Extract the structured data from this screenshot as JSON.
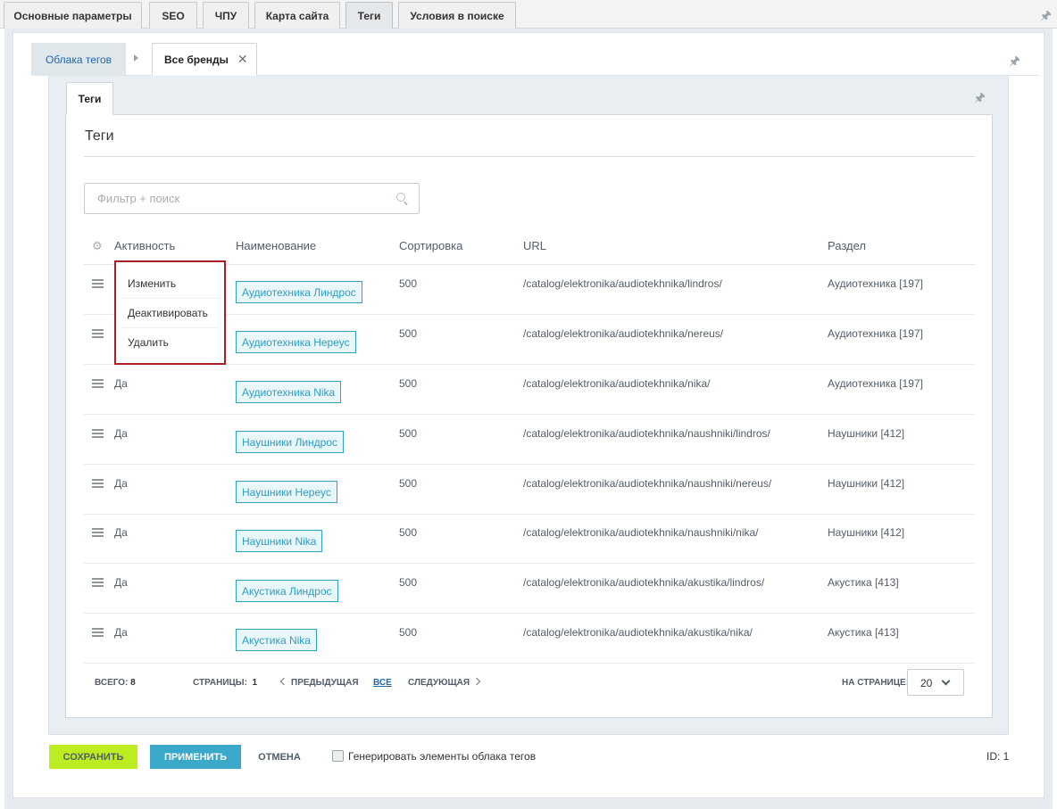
{
  "top_tabs": [
    {
      "label": "Основные параметры"
    },
    {
      "label": "SEO"
    },
    {
      "label": "ЧПУ"
    },
    {
      "label": "Карта сайта"
    },
    {
      "label": "Теги"
    },
    {
      "label": "Условия в поиске"
    }
  ],
  "sub_tabs": {
    "cloud": "Облака тегов",
    "brands": "Все бренды",
    "close": "✕"
  },
  "inner_tab": "Теги",
  "section_title": "Теги",
  "search": {
    "placeholder": "Фильтр + поиск",
    "value": ""
  },
  "table": {
    "headers": {
      "active": "Активность",
      "name": "Наименование",
      "sort": "Сортировка",
      "url": "URL",
      "section": "Раздел"
    },
    "rows": [
      {
        "active": "",
        "name": "Аудиотехника Линдрос",
        "sort": "500",
        "url": "/catalog/elektronika/audiotekhnika/lindros/",
        "section": "Аудиотехника [197]"
      },
      {
        "active": "",
        "name": "Аудиотехника Нереус",
        "sort": "500",
        "url": "/catalog/elektronika/audiotekhnika/nereus/",
        "section": "Аудиотехника [197]"
      },
      {
        "active": "Да",
        "name": "Аудиотехника Nika",
        "sort": "500",
        "url": "/catalog/elektronika/audiotekhnika/nika/",
        "section": "Аудиотехника [197]"
      },
      {
        "active": "Да",
        "name": "Наушники Линдрос",
        "sort": "500",
        "url": "/catalog/elektronika/audiotekhnika/naushniki/lindros/",
        "section": "Наушники [412]"
      },
      {
        "active": "Да",
        "name": "Наушники Нереус",
        "sort": "500",
        "url": "/catalog/elektronika/audiotekhnika/naushniki/nereus/",
        "section": "Наушники [412]"
      },
      {
        "active": "Да",
        "name": "Наушники Nika",
        "sort": "500",
        "url": "/catalog/elektronika/audiotekhnika/naushniki/nika/",
        "section": "Наушники [412]"
      },
      {
        "active": "Да",
        "name": "Акустика Линдрос",
        "sort": "500",
        "url": "/catalog/elektronika/audiotekhnika/akustika/lindros/",
        "section": "Акустика [413]"
      },
      {
        "active": "Да",
        "name": "Акустика Nika",
        "sort": "500",
        "url": "/catalog/elektronika/audiotekhnika/akustika/nika/",
        "section": "Акустика [413]"
      }
    ]
  },
  "context_menu": {
    "edit": "Изменить",
    "deactivate": "Деактивировать",
    "delete": "Удалить"
  },
  "footer": {
    "total_label": "Всего:",
    "total_value": "8",
    "pages_label": "Страницы:",
    "pages_value": "1",
    "prev": "Предыдущая",
    "all": "Все",
    "next": "Следующая",
    "per_page_label": "На странице:",
    "per_page_value": "20"
  },
  "buttons": {
    "save": "Сохранить",
    "apply": "Применить",
    "cancel": "Отмена"
  },
  "generate_label": "Генерировать элементы облака тегов",
  "id_label": "ID: 1",
  "colors": {
    "save_button": "#bbed21",
    "apply_button": "#3aa8c8",
    "tag_border": "#2fa2c0",
    "context_menu_border": "#a81f25"
  }
}
